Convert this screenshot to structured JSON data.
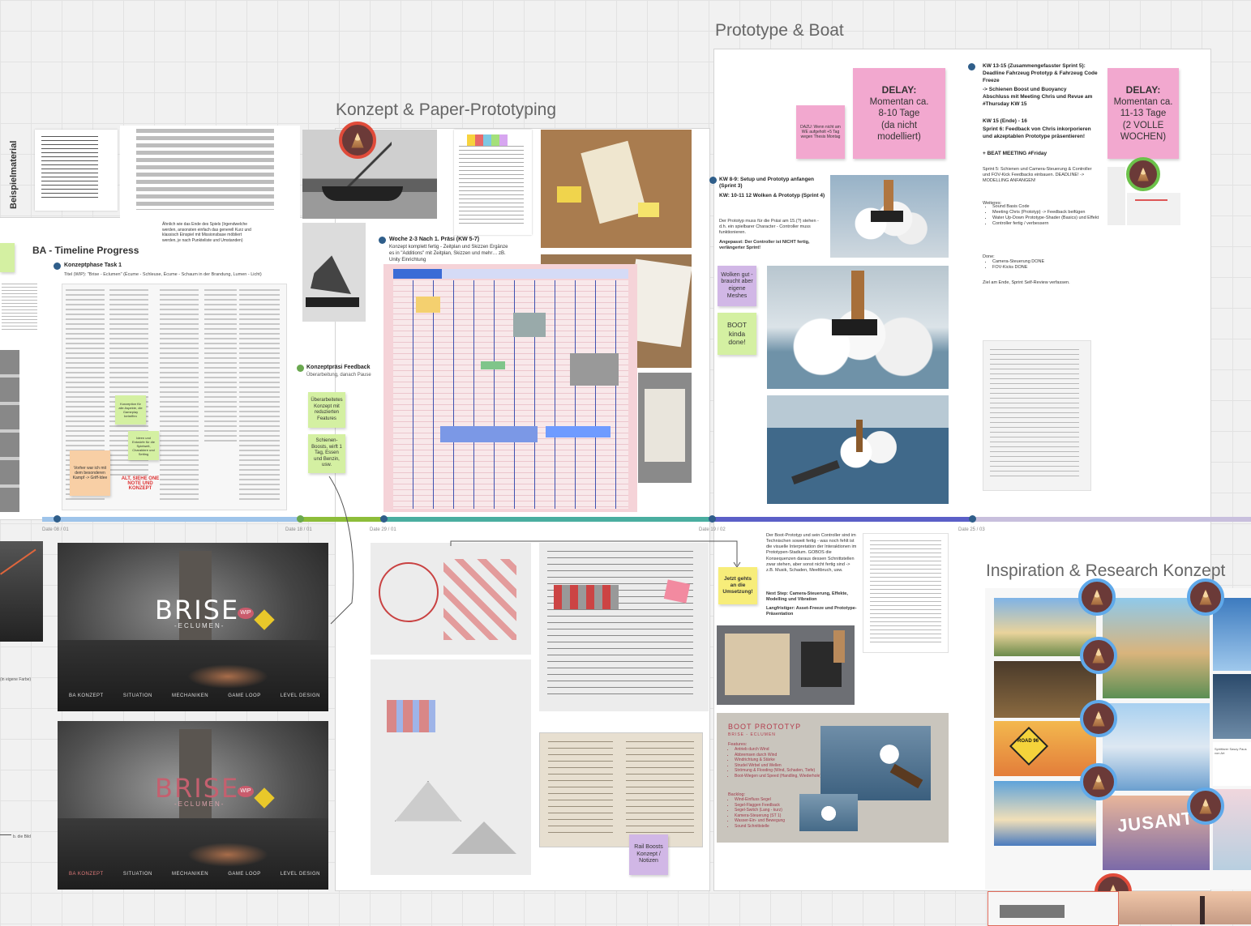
{
  "frames": {
    "prototype_boat": "Prototype & Boat",
    "konzept": "Konzept & Paper-Prototyping",
    "inspiration": "Inspiration & Research Konzept"
  },
  "beispielmaterial": "Beispielmaterial",
  "timeline": {
    "title": "BA - Timeline Progress",
    "task1_title": "Konzeptphase Task 1",
    "task1_subtitle": "Titel (WIP): \"Brise - Eclumen\" (Écume - Schleuse, Écume - Schaum in der Brandung, Lumen - Licht)",
    "feedback_title": "Konzeptpräsi Feedback",
    "feedback_text": "Überarbeitung, danach Pause",
    "woche_title": "Woche 2-3 Nach 1. Präsi (KW 5-7)",
    "woche_text": "Konzept komplett fertig - Zeitplan und Skizzen Ergänze es in \"Additions\" mit Zeitplan, Skizzen und mehr… zB. Unity Einrichtung",
    "kw89_title": "KW 8-9: Setup und Prototyp anfangen (Sprint 3)",
    "kw1012_title": "KW: 10-11 12 Wolken & Prototyp (Sprint 4)",
    "kw89_text": "Der Prototyp muss für die Präsi am 15.(?) stehen - d.h. ein spielbarer Character - Controller muss funktionieren.",
    "kw89_angepasst": "Angepasst: Der Controller ist NICHT fertig, verlängerter Sprint!",
    "kw1315_title": "KW 13-15 (Zusammengefasster Sprint 5): Deadline Fahrzeug Prototyp & Fahrzeug Code Freeze",
    "kw1315_line2": "-> Schienen Boost und Buoyancy",
    "kw1315_line3": "Abschluss mit Meeting Chris und Revue am #Thursday KW 15",
    "kw1516_title": "KW 15 (Ende) - 16",
    "kw1516_line2": "Sprint 6: Feedback von Chris inkorporieren und akzeptablen Prototype präsentieren!",
    "kw1516_line3": "+ BEAT MEETING #Friday",
    "sprint5_text": "Sprint 5: Schienen und Camera-Steuerung & Controller und FOV-Kick Feedbacks einbauen. DEADLINE! -> MODELLING ANFANGEN!",
    "weiteres": "Weiteres:",
    "weiteres_items": [
      "Sound Basis Code",
      "Meeting Chris (Prototyp) -> Feedback beifügen",
      "Water Up-Down Prototype-Shader (Basics) und Effekt",
      "Controller fertig / verbessern"
    ],
    "done": "Done:",
    "done_items": [
      "Camera-Steuerung DONE",
      "FOV-Kicks DONE"
    ],
    "ziel": "Ziel am Ende, Sprint Self-Review verfassen.",
    "boot_text": "Der Boot-Prototyp und sein Controller sind im Technischen soweit fertig - was noch fehlt ist die visuelle Interpretation der Interaktionen im Prototypen-Stadium. GOBOS die Konsequenzen daraus dessen Schnittstellen zwar stehen, aber sonst nicht fertig sind -> z.B. Musik, Schaden, Meeltbruch, usw.",
    "next_step": "Next Step: Camera-Steuerung, Effekte, Modelling und Vibration",
    "langfristiger": "Langfristiger: Asset-Freeze und Prototype-Präsentation",
    "spiels_text": "Ähnlich wie das Ende des Spiels (Irgendwelche werden, ansonsten einfach das generell Kurz und klassisch Einspiel mit Missionsbase möbliert werden, je nach Punkteliste und Umstanden)",
    "dates": [
      "Date 08 / 01",
      "Date 18 / 01",
      "Date 29 / 01",
      "Date 19 / 02",
      "Date 25 / 03"
    ]
  },
  "stickies": {
    "delay1_title": "DELAY:",
    "delay1_lines": [
      "Momentan ca.",
      "8-10 Tage",
      "(da nicht",
      "modelliert)"
    ],
    "delay2_title": "DELAY:",
    "delay2_lines": [
      "Momentan ca.",
      "11-13 Tage",
      "(2 VOLLE",
      "WOCHEN)"
    ],
    "dazu": "DAZU: Wenn nicht am WE aufgeholt +5 Tag wegen Thesis Montag",
    "wolken": "Wolken gut - braucht aber eigene Meshes",
    "boot_done": "BOOT kinda done!",
    "ueberarbeitetes": "Überarbeitetes Konzept mit reduzierten Features",
    "schienen": "Schienen-Boosts, wirft 1 Tag, Essen und Benzin, usw.",
    "jetzt": "Jetzt gehts an die Umsetzung!",
    "rail": "Rail Boosts Konzept / Notizen",
    "alt": "ALT, SIEHE ONE NOTE UND KONZEPT",
    "orange": "Vorher war ich mit dem besonderen Kampf -> Griff-Idee",
    "green_small1": "Konzeption für alle Aspekte, die Gameplay betreffen",
    "green_small2": "Ideen und Entwürfe für die Spielwelt, Charaktere und Setting"
  },
  "brise": {
    "title": "BRISE",
    "subtitle": "-ECLUMEN-",
    "wip": "WIP",
    "road": "ROAD",
    "nav": [
      "BA KONZEPT",
      "SITUATION",
      "MECHANIKEN",
      "GAME LOOP",
      "LEVEL DESIGN"
    ]
  },
  "boot_card": {
    "title": "BOOT PROTOTYP",
    "subtitle": "BRISE - ECLUMEN",
    "features_label": "Features:",
    "features": [
      "Antrieb durch Wind",
      "Abbremsen durch Wind",
      "Windrichtung & Stärke",
      "Strudel Wirbel und Wellen",
      "Strömung & Flooding (Wind, Schaden, Tiefe)",
      "Boot-Wiegen und Speed (Handling, Wiederhole)"
    ],
    "backlog_label": "Backlog:",
    "backlog": [
      "Wind-Einfluss Segel",
      "Segel-Flaggen Feedback",
      "Segel-Switch (Lang - kurz)",
      "Kamera-Steuerung (ST 1)",
      "Wasser-Ein- und Bewegung",
      "Sound Schnittstelle"
    ]
  },
  "insp": {
    "jusant": "JUSANT",
    "road96": "ROAD 96",
    "spiritfarer": "Spiritfarer Saszy Paus von Art"
  },
  "misc": {
    "left_text": "(in eigene Farbe)",
    "left_small": "b. die Bild"
  },
  "colors": {
    "timeline_blue": "#9ec4ea",
    "timeline_green": "#8dbd3a",
    "timeline_teal": "#4aaea0",
    "timeline_indigo": "#5b5fc7",
    "timeline_lilac": "#c8bfdd",
    "sticky_pink": "#f2a8cf",
    "sticky_purple": "#d1b7e6",
    "sticky_green": "#d4f0a2",
    "dot_blue": "#2f5e8a",
    "dot_green": "#6aa84f"
  }
}
